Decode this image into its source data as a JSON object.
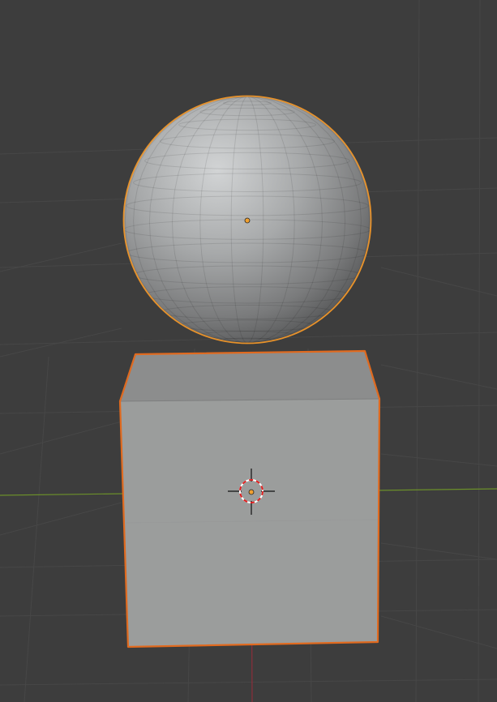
{
  "app": {
    "view": "3D Viewport",
    "shading": "solid"
  },
  "colors": {
    "background": "#3d3d3d",
    "grid": "#474747",
    "x_axis": "#8b2e3a",
    "y_axis": "#6b8f2a",
    "selection_outline": "#e8922a",
    "active_outline": "#e06a1f",
    "origin_dot": "#f0a030",
    "cursor_red": "#e02020",
    "cursor_white": "#ffffff"
  },
  "scene": {
    "objects": [
      {
        "name": "sphere",
        "type": "uv-sphere",
        "selected": true
      },
      {
        "name": "cube",
        "type": "cube",
        "selected": true,
        "active": true
      }
    ],
    "icons": [
      "3d-cursor-icon"
    ]
  }
}
